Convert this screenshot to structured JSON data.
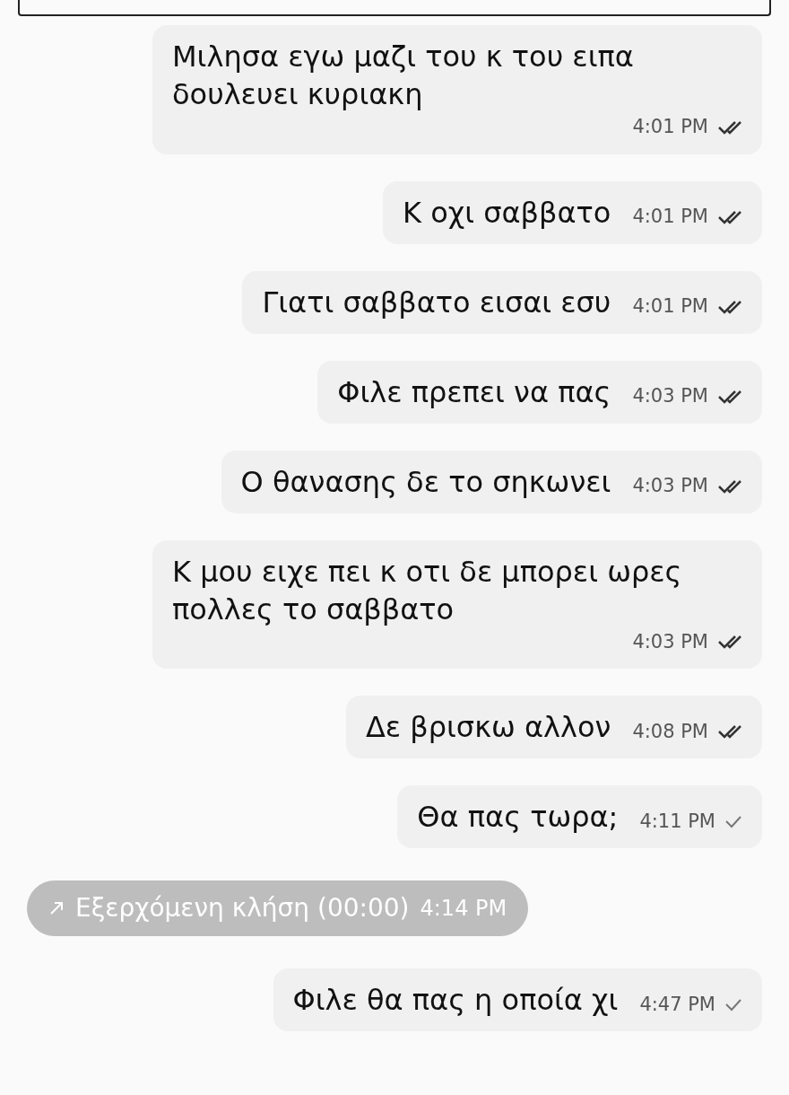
{
  "messages": [
    {
      "kind": "text",
      "text": "Μιλησα εγω μαζι του κ του ειπα δουλευει κυριακη",
      "time": "4:01 PM",
      "read": true
    },
    {
      "kind": "text",
      "text": "Κ οχι σαββατο",
      "time": "4:01 PM",
      "read": true
    },
    {
      "kind": "text",
      "text": "Γιατι σαββατο εισαι εσυ",
      "time": "4:01 PM",
      "read": true
    },
    {
      "kind": "text",
      "text": "Φιλε πρεπει να πας",
      "time": "4:03 PM",
      "read": true
    },
    {
      "kind": "text",
      "text": "Ο θανασης δε το σηκωνει",
      "time": "4:03 PM",
      "read": true
    },
    {
      "kind": "text",
      "text": "Κ μου ειχε πει κ οτι δε μπορει ωρες πολλες το σαββατο",
      "time": "4:03 PM",
      "read": true
    },
    {
      "kind": "text",
      "text": "Δε βρισκω αλλον",
      "time": "4:08 PM",
      "read": true
    },
    {
      "kind": "text",
      "text": "Θα πας τωρα;",
      "time": "4:11 PM",
      "read": false
    },
    {
      "kind": "call",
      "text": "Εξερχόμενη κλήση (00:00)",
      "time": "4:14 PM"
    },
    {
      "kind": "text",
      "text": "Φιλε θα πας η οποία χι",
      "time": "4:47 PM",
      "read": false
    }
  ]
}
